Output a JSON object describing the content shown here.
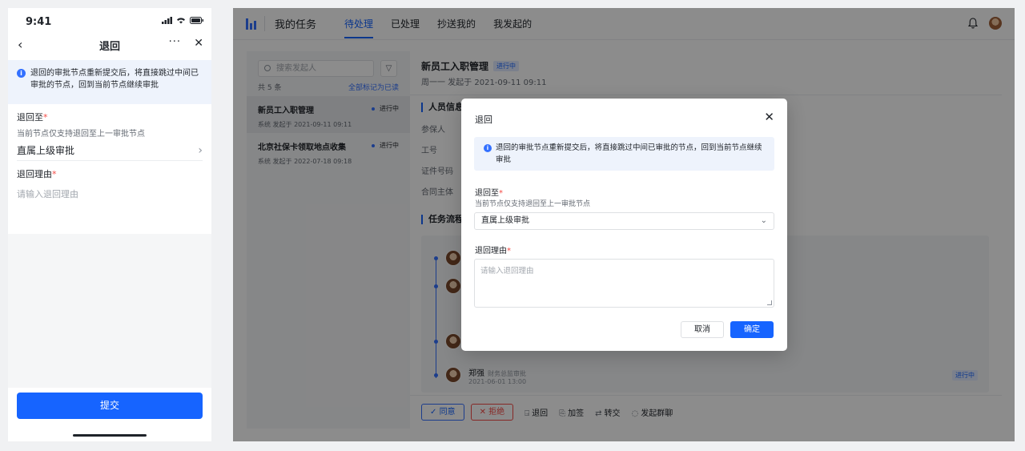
{
  "mobile": {
    "time": "9:41",
    "nav": {
      "title": "退回",
      "more": "···"
    },
    "notice": "退回的审批节点重新提交后，将直接跳过中间已审批的节点，回到当前节点继续审批",
    "return_to": {
      "label": "退回至",
      "required": "*",
      "hint": "当前节点仅支持退回至上一审批节点",
      "value": "直属上级审批"
    },
    "reason": {
      "label": "退回理由",
      "required": "*",
      "placeholder": "请输入退回理由"
    },
    "submit_label": "提交"
  },
  "desktop": {
    "app_title": "我的任务",
    "tabs": [
      {
        "label": "待处理",
        "active": true
      },
      {
        "label": "已处理"
      },
      {
        "label": "抄送我的"
      },
      {
        "label": "我发起的"
      }
    ],
    "list": {
      "search_placeholder": "搜索发起人",
      "count": "共 5 条",
      "mark_all": "全部标记为已读",
      "items": [
        {
          "title": "新员工入职管理",
          "meta": "系统 发起于 2021-09-11 09:11",
          "status": "进行中"
        },
        {
          "title": "北京社保卡领取地点收集",
          "meta": "系统 发起于 2022-07-18 09:18",
          "status": "进行中"
        }
      ]
    },
    "detail": {
      "title": "新员工入职管理",
      "tag": "进行中",
      "subtitle": "周一一 发起于 2021-09-11 09:11",
      "section_person": "人员信息",
      "fields": [
        "参保人",
        "工号",
        "证件号码",
        "合同主体"
      ],
      "section_flow": "任务流程",
      "flow_last": {
        "name": "郑强",
        "role": "财务总监审批",
        "time": "2021-06-01 13:00",
        "tag": "进行中"
      }
    },
    "actions": {
      "agree": "同意",
      "reject": "拒绝",
      "return": "退回",
      "add_sign": "加签",
      "transfer": "转交",
      "group_chat": "发起群聊"
    }
  },
  "modal": {
    "title": "退回",
    "notice": "退回的审批节点重新提交后，将直接跳过中间已审批的节点，回到当前节点继续审批",
    "return_to": {
      "label": "退回至",
      "required": "*",
      "hint": "当前节点仅支持退回至上一审批节点",
      "value": "直属上级审批"
    },
    "reason": {
      "label": "退回理由",
      "required": "*",
      "placeholder": "请输入退回理由"
    },
    "cancel_label": "取消",
    "ok_label": "确定"
  },
  "colors": {
    "primary": "#1664ff",
    "danger": "#f54a45",
    "mask": "rgba(0,0,0,0.45)"
  }
}
